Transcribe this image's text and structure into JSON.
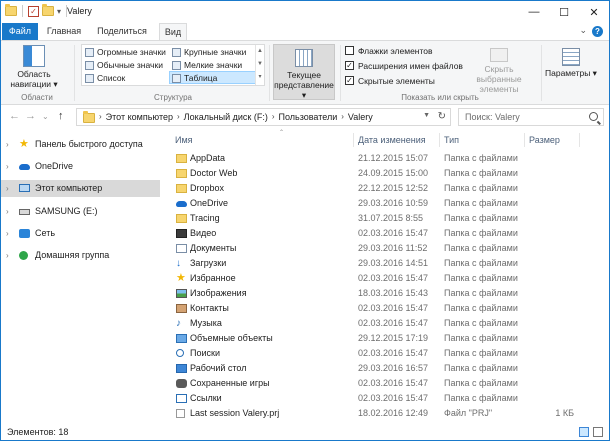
{
  "window": {
    "title": "Valery",
    "minimize": "—",
    "maximize": "☐",
    "close": "✕"
  },
  "tabs": {
    "file": "Файл",
    "home": "Главная",
    "share": "Поделиться",
    "view": "Вид",
    "collapse": "⌄",
    "help": "?"
  },
  "ribbon": {
    "nav_pane": "Область навигации ▾",
    "panels_group": "Области",
    "layout_items": {
      "huge": "Огромные значки",
      "large": "Крупные значки",
      "normal": "Обычные значки",
      "small": "Мелкие значки",
      "list": "Список",
      "table": "Таблица"
    },
    "layout_group": "Структура",
    "current_view": "Текущее представление ▾",
    "checks": {
      "item_checkboxes": "Флажки элементов",
      "file_extensions": "Расширения имен файлов",
      "hidden_items": "Скрытые элементы"
    },
    "check_states": {
      "item_checkboxes": "",
      "file_extensions": "✓",
      "hidden_items": "✓"
    },
    "hide_selected": "Скрыть выбранные элементы",
    "show_hide_group": "Показать или скрыть",
    "options": "Параметры ▾"
  },
  "address": {
    "back": "←",
    "forward": "→",
    "recent": "⌄",
    "up": "↑",
    "crumbs": [
      "Этот компьютер",
      "Локальный диск (F:)",
      "Пользователи",
      "Valery"
    ],
    "crumb_sep": "›",
    "dropdown": "▼",
    "refresh": "↻",
    "search_placeholder": "Поиск: Valery"
  },
  "nav": {
    "quick_access": "Панель быстрого доступа",
    "onedrive": "OneDrive",
    "this_pc": "Этот компьютер",
    "samsung": "SAMSUNG (E:)",
    "network": "Сеть",
    "homegroup": "Домашняя группа",
    "chevron": "›"
  },
  "columns": {
    "name": "Имя",
    "date": "Дата изменения",
    "type": "Тип",
    "size": "Размер",
    "sort_caret": "⌃"
  },
  "files": [
    {
      "name": "AppData",
      "date": "21.12.2015 15:07",
      "type": "Папка с файлами",
      "size": "",
      "icon": "folder"
    },
    {
      "name": "Doctor Web",
      "date": "24.09.2015 15:00",
      "type": "Папка с файлами",
      "size": "",
      "icon": "folder"
    },
    {
      "name": "Dropbox",
      "date": "22.12.2015 12:52",
      "type": "Папка с файлами",
      "size": "",
      "icon": "folder"
    },
    {
      "name": "OneDrive",
      "date": "29.03.2016 10:59",
      "type": "Папка с файлами",
      "size": "",
      "icon": "cloud"
    },
    {
      "name": "Tracing",
      "date": "31.07.2015 8:55",
      "type": "Папка с файлами",
      "size": "",
      "icon": "folder"
    },
    {
      "name": "Видео",
      "date": "02.03.2016 15:47",
      "type": "Папка с файлами",
      "size": "",
      "icon": "video"
    },
    {
      "name": "Документы",
      "date": "29.03.2016 11:52",
      "type": "Папка с файлами",
      "size": "",
      "icon": "document"
    },
    {
      "name": "Загрузки",
      "date": "29.03.2016 14:51",
      "type": "Папка с файлами",
      "size": "",
      "icon": "download"
    },
    {
      "name": "Избранное",
      "date": "02.03.2016 15:47",
      "type": "Папка с файлами",
      "size": "",
      "icon": "star"
    },
    {
      "name": "Изображения",
      "date": "18.03.2016 15:43",
      "type": "Папка с файлами",
      "size": "",
      "icon": "photo"
    },
    {
      "name": "Контакты",
      "date": "02.03.2016 15:47",
      "type": "Папка с файлами",
      "size": "",
      "icon": "contact"
    },
    {
      "name": "Музыка",
      "date": "02.03.2016 15:47",
      "type": "Папка с файлами",
      "size": "",
      "icon": "music"
    },
    {
      "name": "Объемные объекты",
      "date": "29.12.2015 17:19",
      "type": "Папка с файлами",
      "size": "",
      "icon": "cube"
    },
    {
      "name": "Поиски",
      "date": "02.03.2016 15:47",
      "type": "Папка с файлами",
      "size": "",
      "icon": "search"
    },
    {
      "name": "Рабочий стол",
      "date": "29.03.2016 16:57",
      "type": "Папка с файлами",
      "size": "",
      "icon": "desktop"
    },
    {
      "name": "Сохраненные игры",
      "date": "02.03.2016 15:47",
      "type": "Папка с файлами",
      "size": "",
      "icon": "game"
    },
    {
      "name": "Ссылки",
      "date": "02.03.2016 15:47",
      "type": "Папка с файлами",
      "size": "",
      "icon": "link"
    },
    {
      "name": "Last session Valery.prj",
      "date": "18.02.2016 12:49",
      "type": "Файл \"PRJ\"",
      "size": "1 КБ",
      "icon": "file"
    }
  ],
  "status": {
    "items": "Элементов: 18"
  }
}
